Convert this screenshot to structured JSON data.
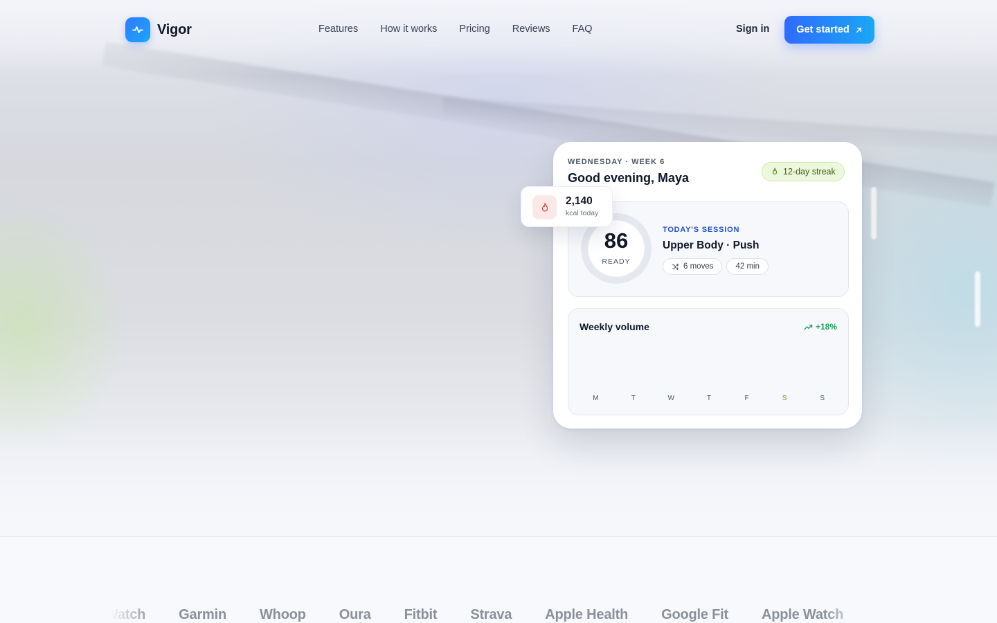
{
  "brand": {
    "name": "Vigor",
    "logo_icon": "activity-pulse-icon",
    "accent": "#2f6bff"
  },
  "nav": {
    "links": [
      "Features",
      "How it works",
      "Pricing",
      "Reviews",
      "FAQ"
    ],
    "sign_in": "Sign in",
    "cta": "Get started",
    "cta_icon": "arrow-up-right-icon"
  },
  "dashboard": {
    "day_label": "WEDNESDAY · WEEK 6",
    "greeting": "Good evening, Maya",
    "streak": "12-day streak",
    "readiness": {
      "score": "86",
      "label": "READY",
      "fraction": 0.86
    },
    "session": {
      "label": "TODAY'S SESSION",
      "title": "Upper Body · Push",
      "moves": "6 moves",
      "duration": "42 min"
    },
    "weekly": {
      "title": "Weekly volume",
      "delta": "+18%",
      "days": [
        "M",
        "T",
        "W",
        "T",
        "F",
        "S",
        "S"
      ],
      "highlight_day_index": 5
    }
  },
  "kcal": {
    "value": "2,140",
    "label": "kcal today"
  },
  "integrations": [
    "Apple Watch",
    "Garmin",
    "Whoop",
    "Oura",
    "Fitbit",
    "Strava",
    "Apple Health",
    "Google Fit",
    "Apple Watch"
  ]
}
